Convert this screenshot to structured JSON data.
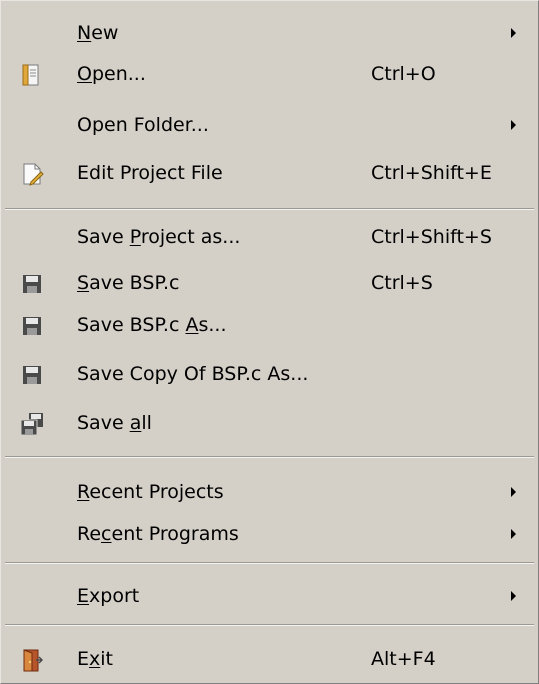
{
  "menu": {
    "items": [
      {
        "pre": "",
        "ul": "N",
        "post": "ew",
        "shortcut": "",
        "submenu": true,
        "icon": ""
      },
      {
        "pre": "",
        "ul": "O",
        "post": "pen...",
        "shortcut": "Ctrl+O",
        "submenu": false,
        "icon": "open-document-icon"
      },
      {
        "pre": "Open Folder...",
        "ul": "",
        "post": "",
        "shortcut": "",
        "submenu": true,
        "icon": ""
      },
      {
        "pre": "Edit Project File",
        "ul": "",
        "post": "",
        "shortcut": "Ctrl+Shift+E",
        "submenu": false,
        "icon": "edit-file-icon"
      },
      {
        "pre": "Save ",
        "ul": "P",
        "post": "roject as...",
        "shortcut": "Ctrl+Shift+S",
        "submenu": false,
        "icon": ""
      },
      {
        "pre": "",
        "ul": "S",
        "post": "ave BSP.c",
        "shortcut": "Ctrl+S",
        "submenu": false,
        "icon": "floppy-disk-icon"
      },
      {
        "pre": "Save BSP.c ",
        "ul": "A",
        "post": "s...",
        "shortcut": "",
        "submenu": false,
        "icon": "floppy-disk-icon"
      },
      {
        "pre": "Save Copy Of BSP.c As...",
        "ul": "",
        "post": "",
        "shortcut": "",
        "submenu": false,
        "icon": "floppy-disk-icon"
      },
      {
        "pre": "Save ",
        "ul": "a",
        "post": "ll",
        "shortcut": "",
        "submenu": false,
        "icon": "save-all-icon"
      },
      {
        "pre": "",
        "ul": "R",
        "post": "ecent Projects",
        "shortcut": "",
        "submenu": true,
        "icon": ""
      },
      {
        "pre": "Re",
        "ul": "c",
        "post": "ent Programs",
        "shortcut": "",
        "submenu": true,
        "icon": ""
      },
      {
        "pre": "",
        "ul": "E",
        "post": "xport",
        "shortcut": "",
        "submenu": true,
        "icon": ""
      },
      {
        "pre": "E",
        "ul": "x",
        "post": "it",
        "shortcut": "Alt+F4",
        "submenu": false,
        "icon": "exit-door-icon"
      }
    ]
  }
}
